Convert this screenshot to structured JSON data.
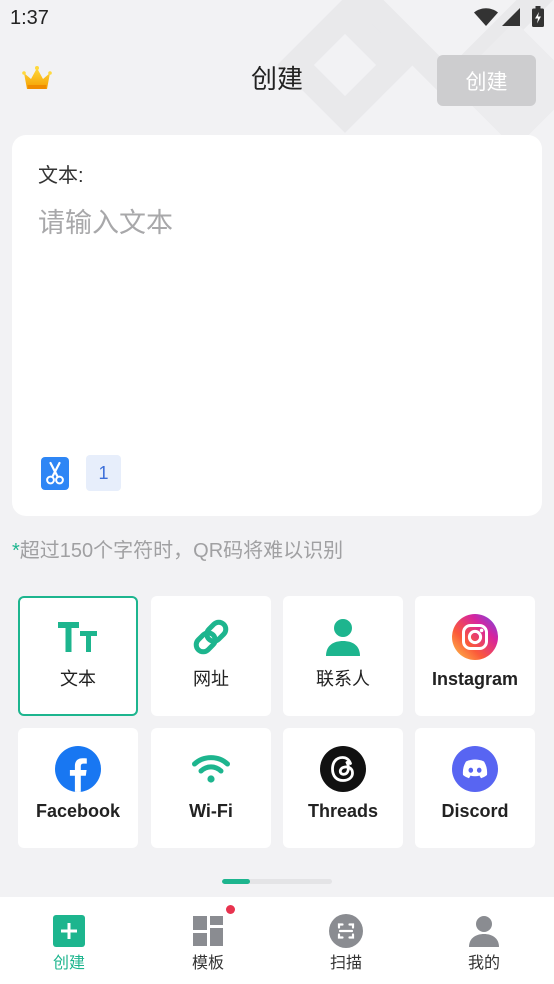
{
  "status_bar": {
    "time": "1:37",
    "icons": [
      "wifi-icon",
      "cell-signal-icon",
      "battery-charging-icon"
    ]
  },
  "header": {
    "title": "创建",
    "create_button": "创建",
    "left_icon": "crown-icon"
  },
  "editor": {
    "label": "文本:",
    "placeholder": "请输入文本",
    "value": "",
    "tool_icon": "scissors-icon",
    "count": "1"
  },
  "hint": {
    "asterisk": "*",
    "text": "超过150个字符时，QR码将难以识别"
  },
  "types": [
    {
      "label": "文本",
      "icon": "text-type-icon",
      "selected": true
    },
    {
      "label": "网址",
      "icon": "link-icon",
      "selected": false
    },
    {
      "label": "联系人",
      "icon": "contact-icon",
      "selected": false
    },
    {
      "label": "Instagram",
      "icon": "instagram-icon",
      "selected": false
    },
    {
      "label": "Facebook",
      "icon": "facebook-icon",
      "selected": false
    },
    {
      "label": "Wi-Fi",
      "icon": "wifi-icon",
      "selected": false
    },
    {
      "label": "Threads",
      "icon": "threads-icon",
      "selected": false
    },
    {
      "label": "Discord",
      "icon": "discord-icon",
      "selected": false
    }
  ],
  "scroll_indicator": {
    "fill_fraction": 0.25
  },
  "bottom_nav": [
    {
      "label": "创建",
      "icon": "plus-square-icon",
      "active": true,
      "badge_dot": false
    },
    {
      "label": "模板",
      "icon": "template-grid-icon",
      "active": false,
      "badge_dot": true
    },
    {
      "label": "扫描",
      "icon": "scan-icon",
      "active": false,
      "badge_dot": false
    },
    {
      "label": "我的",
      "icon": "profile-icon",
      "active": false,
      "badge_dot": false
    }
  ],
  "colors": {
    "accent": "#1db58e",
    "create_button_bg": "#cdcdcf",
    "badge_dot": "#e8334f",
    "scissors_icon": "#2e86f5",
    "facebook": "#1877f2",
    "discord": "#5865f2",
    "threads": "#111111",
    "inactive_icon": "#8a8c91"
  }
}
